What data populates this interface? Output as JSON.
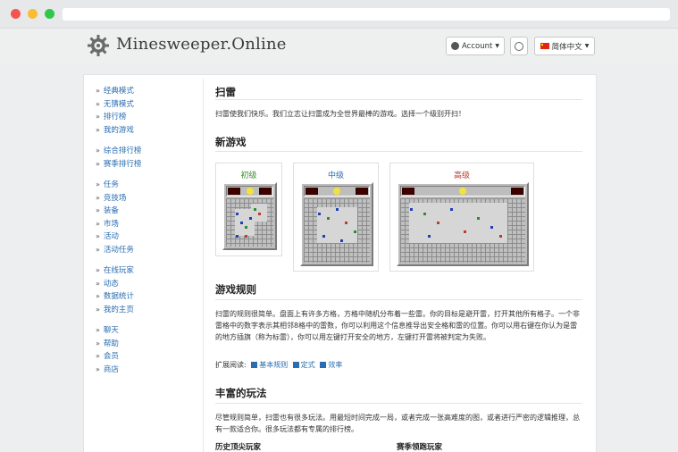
{
  "site": {
    "name": "Minesweeper.Online",
    "account_label": "Account",
    "language_label": "简体中文"
  },
  "sidebar": {
    "groups": [
      [
        "经典模式",
        "无猜模式",
        "排行榜",
        "我的游戏"
      ],
      [
        "综合排行榜",
        "赛季排行榜"
      ],
      [
        "任务",
        "竞技场",
        "装备",
        "市场",
        "活动",
        "活动任务"
      ],
      [
        "在线玩家",
        "动态",
        "数据统计",
        "我的主页"
      ],
      [
        "聊天",
        "帮助",
        "会员",
        "商店"
      ]
    ]
  },
  "main": {
    "title": "扫雷",
    "intro": "扫雷使我们快乐。我们立志让扫雷成为全世界最棒的游戏。选择一个级别开扫！",
    "new_game_title": "新游戏",
    "levels": [
      {
        "label": "初级",
        "color": "#3a8a2f"
      },
      {
        "label": "中级",
        "color": "#2a6db0"
      },
      {
        "label": "高级",
        "color": "#c0392b"
      }
    ],
    "rules_title": "游戏规则",
    "rules_text": "扫雷的规则很简单。盘面上有许多方格，方格中随机分布着一些雷。你的目标是避开雷，打开其他所有格子。一个非雷格中的数字表示其相邻8格中的雷数，你可以利用这个信息推导出安全格和雷的位置。你可以用右键在你认为是雷的地方插旗（称为标雷），你可以用左键打开安全的地方，左键打开雷将被判定为失败。",
    "extended_label": "扩展阅读:",
    "extended_links": [
      "基本规则",
      "定式",
      "效率"
    ],
    "rich_title": "丰富的玩法",
    "rich_text": "尽管规则简单，扫雷也有很多玩法。用最短时间完成一局，或者完成一张高难度的图，或者进行严密的逻辑推理，总有一款适合你。很多玩法都有专属的排行榜。",
    "col_left": "历史顶尖玩家",
    "col_right": "赛季领跑玩家"
  },
  "colors": {
    "link": "#2a6db0",
    "lcd": "#3b0000",
    "board": "#bdbdbd"
  }
}
